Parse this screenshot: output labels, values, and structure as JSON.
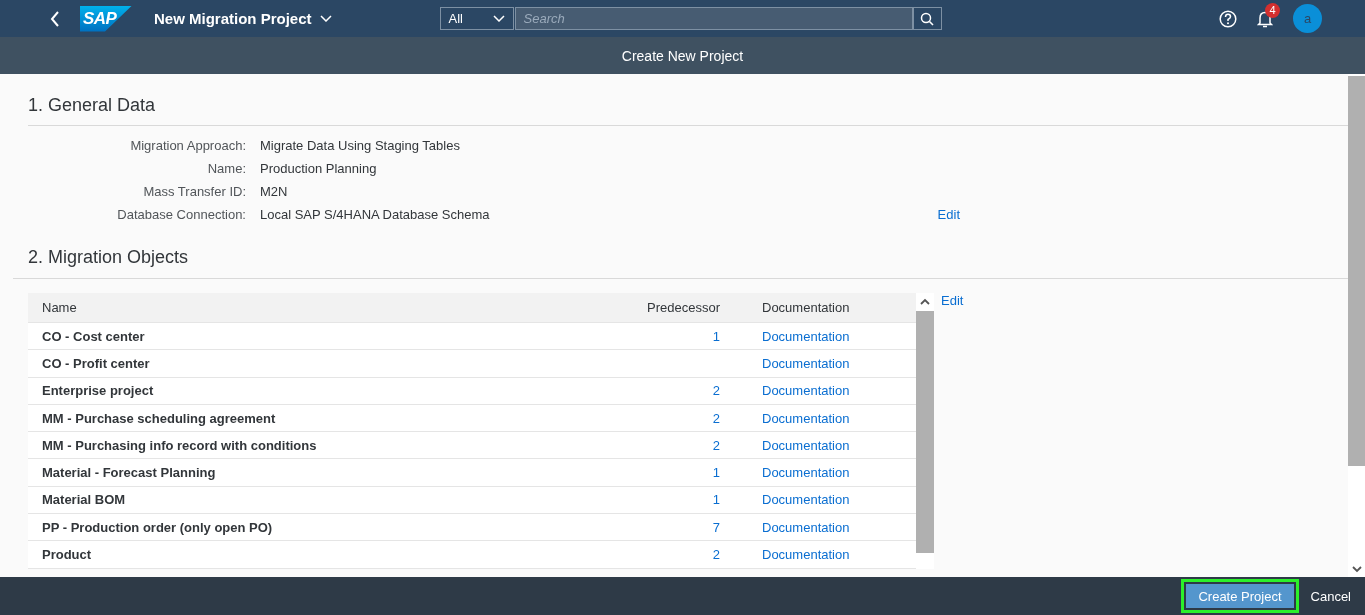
{
  "shell": {
    "logo_text": "SAP",
    "title": "New Migration Project",
    "search_scope": "All",
    "search_placeholder": "Search",
    "notification_count": "4",
    "avatar_initial": "a"
  },
  "page_title": "Create New Project",
  "general_data": {
    "heading": "1. General Data",
    "edit_link": "Edit",
    "fields": [
      {
        "label": "Migration Approach:",
        "value": "Migrate Data Using Staging Tables"
      },
      {
        "label": "Name:",
        "value": "Production Planning"
      },
      {
        "label": "Mass Transfer ID:",
        "value": "M2N"
      },
      {
        "label": "Database Connection:",
        "value": "Local SAP S/4HANA Database Schema"
      }
    ]
  },
  "migration_objects": {
    "heading": "2. Migration Objects",
    "edit_link": "Edit",
    "columns": [
      "Name",
      "Predecessor",
      "Documentation"
    ],
    "rows": [
      {
        "name": "CO - Cost center",
        "predecessor": "1",
        "documentation": "Documentation"
      },
      {
        "name": "CO - Profit center",
        "documentation": "Documentation"
      },
      {
        "name": "Enterprise project",
        "predecessor": "2",
        "documentation": "Documentation"
      },
      {
        "name": "MM - Purchase scheduling agreement",
        "predecessor": "2",
        "documentation": "Documentation"
      },
      {
        "name": "MM - Purchasing info record with conditions",
        "predecessor": "2",
        "documentation": "Documentation"
      },
      {
        "name": "Material - Forecast Planning",
        "predecessor": "1",
        "documentation": "Documentation"
      },
      {
        "name": "Material BOM",
        "predecessor": "1",
        "documentation": "Documentation"
      },
      {
        "name": "PP - Production order (only open PO)",
        "predecessor": "7",
        "documentation": "Documentation"
      },
      {
        "name": "Product",
        "predecessor": "2",
        "documentation": "Documentation"
      }
    ]
  },
  "footer": {
    "buttons": [
      {
        "label": "Create Project",
        "kind": "emphasized",
        "highlighted": true
      },
      {
        "label": "Cancel",
        "kind": "transparent",
        "highlighted": false
      }
    ]
  }
}
